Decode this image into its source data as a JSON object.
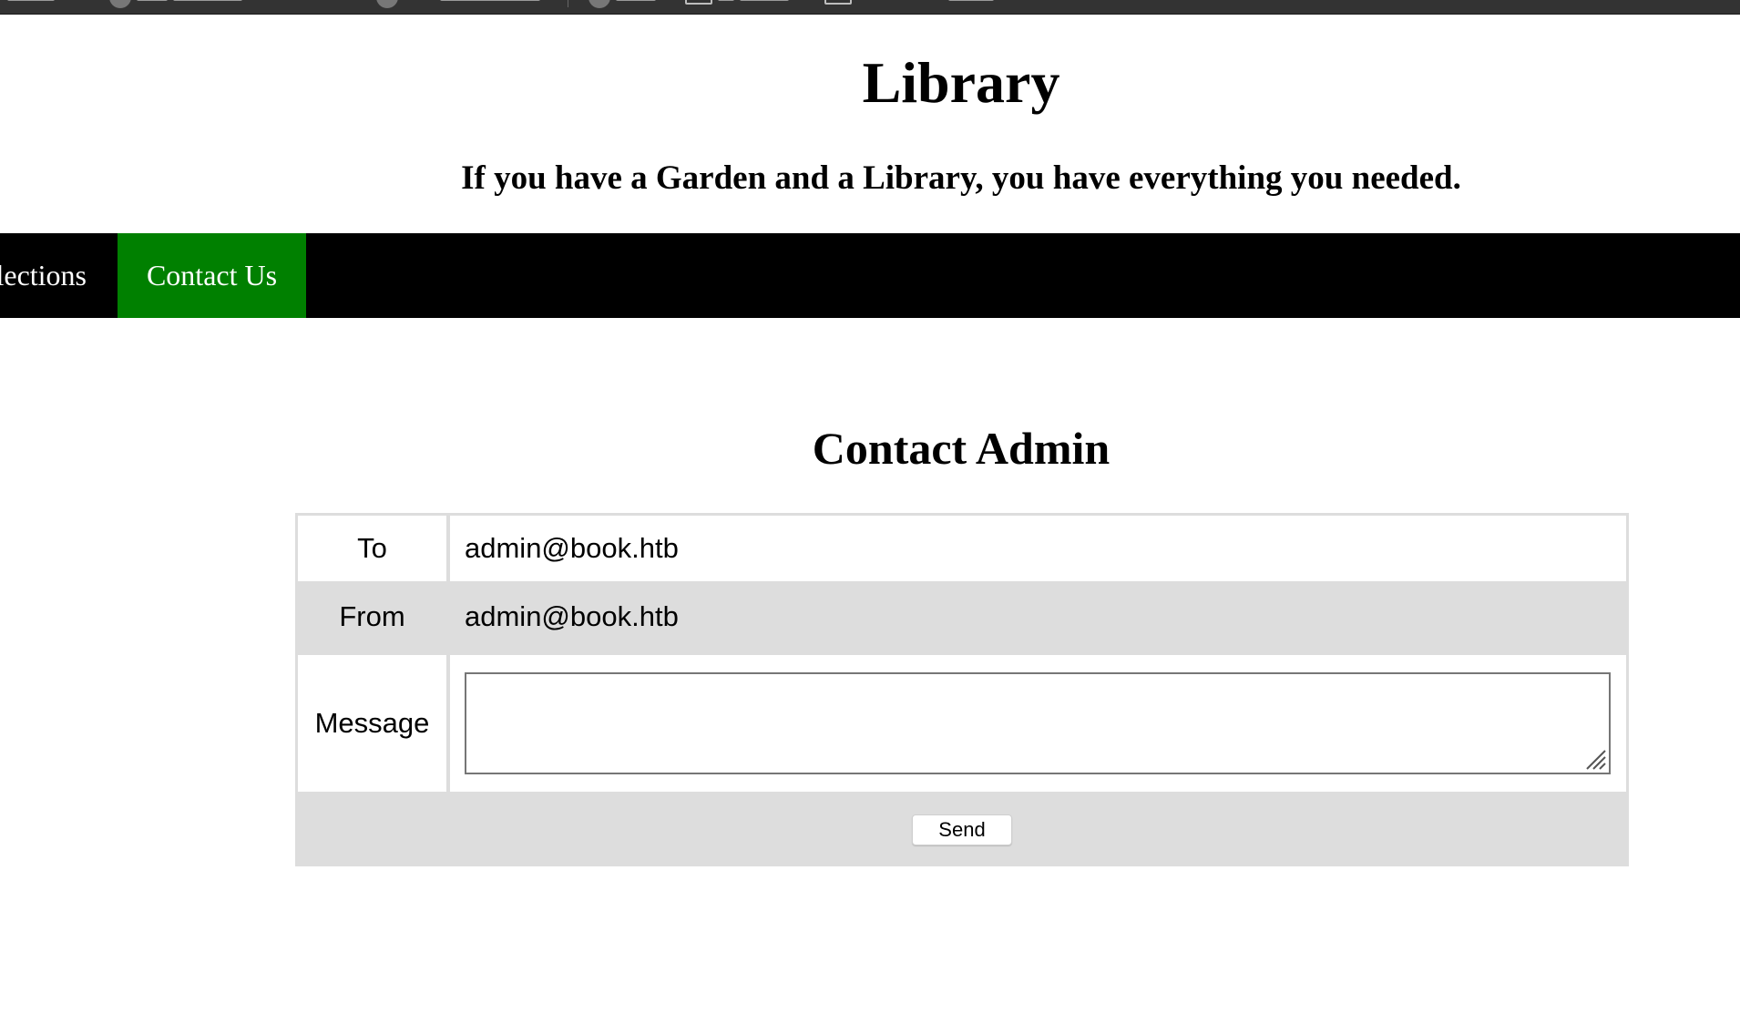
{
  "site": {
    "title": "Library",
    "tagline": "If you have a Garden and a Library, you have everything you needed."
  },
  "nav": {
    "items": [
      {
        "label": "Collections",
        "visible_text": "llections",
        "active": false
      },
      {
        "label": "Contact Us",
        "active": true
      }
    ],
    "active_color": "#008000",
    "bar_color": "#000000"
  },
  "contact": {
    "heading": "Contact Admin",
    "to_label": "To",
    "to_value": "admin@book.htb",
    "from_label": "From",
    "from_value": "admin@book.htb",
    "message_label": "Message",
    "message_value": "",
    "send_label": "Send"
  }
}
